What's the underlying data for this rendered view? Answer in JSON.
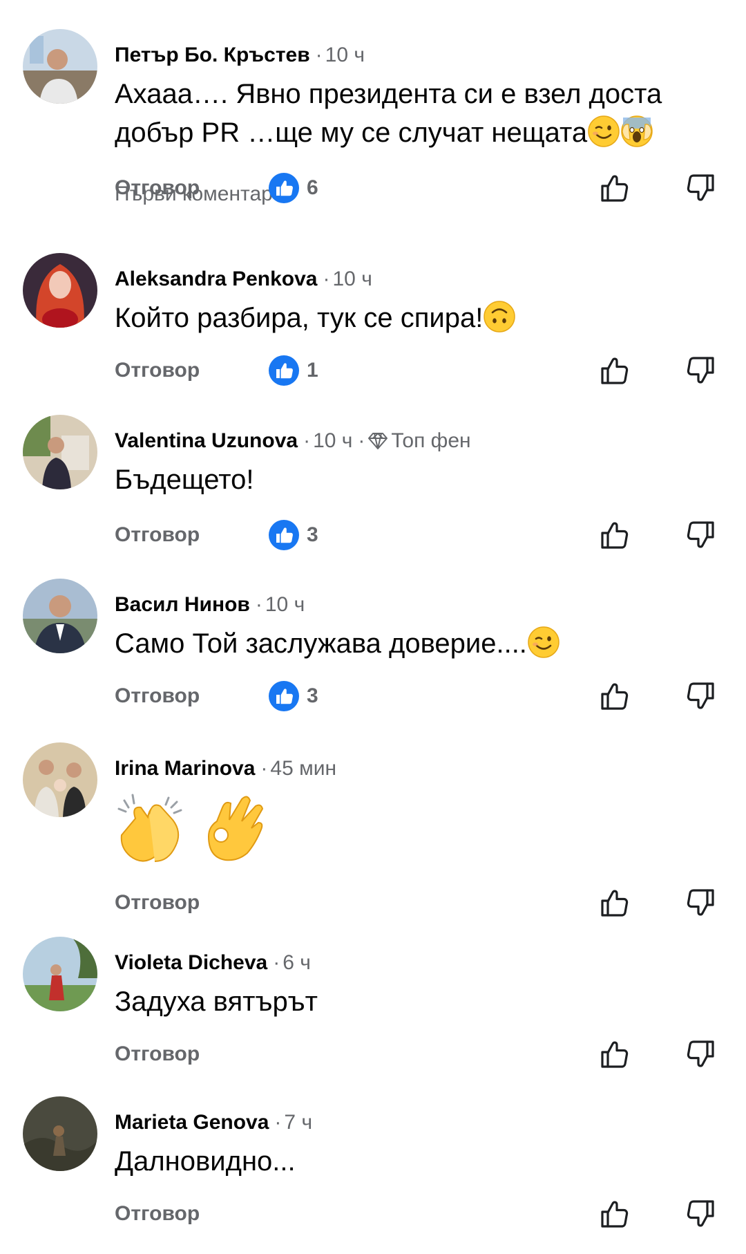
{
  "colors": {
    "like_blue": "#1877f2",
    "secondary_text": "#65676b",
    "primary_text": "#050505"
  },
  "reply_label": "Отговор",
  "comments": [
    {
      "author": "Петър Бо. Кръстев",
      "time": "10 ч",
      "text": "Ахааа…. Явно президента си е взел доста добър PR …ще му се случат нещата",
      "emojis": [
        "winking-face",
        "face-screaming-in-fear"
      ],
      "tag": "Първи коментар",
      "reactions": "6"
    },
    {
      "author": "Aleksandra Penkova",
      "time": "10 ч",
      "text": "Който разбира, тук се спира!",
      "emojis": [
        "upside-down-face"
      ],
      "reactions": "1"
    },
    {
      "author": "Valentina Uzunova",
      "time": "10 ч",
      "badge": "Топ фен",
      "text": "Бъдещето!",
      "reactions": "3"
    },
    {
      "author": "Васил Нинов",
      "time": "10 ч",
      "text": "Само Той заслужава доверие....",
      "emojis": [
        "winking-face"
      ],
      "reactions": "3"
    },
    {
      "author": "Irina Marinova",
      "time": "45 мин",
      "emojis": [
        "clapping-hands",
        "ok-hand"
      ]
    },
    {
      "author": "Violeta Dicheva",
      "time": "6 ч",
      "text": "Задуха вятърът"
    },
    {
      "author": "Marieta Genova",
      "time": "7 ч",
      "text": "Далновидно..."
    }
  ]
}
